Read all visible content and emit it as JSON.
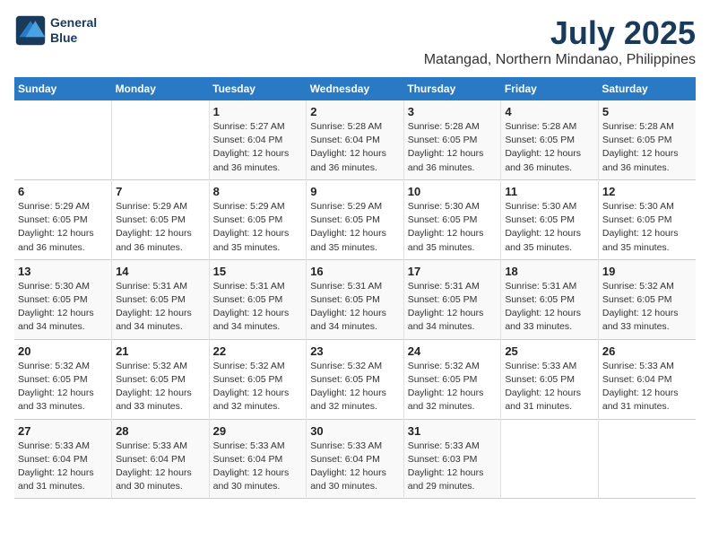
{
  "header": {
    "logo_line1": "General",
    "logo_line2": "Blue",
    "title": "July 2025",
    "subtitle": "Matangad, Northern Mindanao, Philippines"
  },
  "days_of_week": [
    "Sunday",
    "Monday",
    "Tuesday",
    "Wednesday",
    "Thursday",
    "Friday",
    "Saturday"
  ],
  "weeks": [
    [
      {
        "day": "",
        "info": ""
      },
      {
        "day": "",
        "info": ""
      },
      {
        "day": "1",
        "info": "Sunrise: 5:27 AM\nSunset: 6:04 PM\nDaylight: 12 hours and 36 minutes."
      },
      {
        "day": "2",
        "info": "Sunrise: 5:28 AM\nSunset: 6:04 PM\nDaylight: 12 hours and 36 minutes."
      },
      {
        "day": "3",
        "info": "Sunrise: 5:28 AM\nSunset: 6:05 PM\nDaylight: 12 hours and 36 minutes."
      },
      {
        "day": "4",
        "info": "Sunrise: 5:28 AM\nSunset: 6:05 PM\nDaylight: 12 hours and 36 minutes."
      },
      {
        "day": "5",
        "info": "Sunrise: 5:28 AM\nSunset: 6:05 PM\nDaylight: 12 hours and 36 minutes."
      }
    ],
    [
      {
        "day": "6",
        "info": "Sunrise: 5:29 AM\nSunset: 6:05 PM\nDaylight: 12 hours and 36 minutes."
      },
      {
        "day": "7",
        "info": "Sunrise: 5:29 AM\nSunset: 6:05 PM\nDaylight: 12 hours and 36 minutes."
      },
      {
        "day": "8",
        "info": "Sunrise: 5:29 AM\nSunset: 6:05 PM\nDaylight: 12 hours and 35 minutes."
      },
      {
        "day": "9",
        "info": "Sunrise: 5:29 AM\nSunset: 6:05 PM\nDaylight: 12 hours and 35 minutes."
      },
      {
        "day": "10",
        "info": "Sunrise: 5:30 AM\nSunset: 6:05 PM\nDaylight: 12 hours and 35 minutes."
      },
      {
        "day": "11",
        "info": "Sunrise: 5:30 AM\nSunset: 6:05 PM\nDaylight: 12 hours and 35 minutes."
      },
      {
        "day": "12",
        "info": "Sunrise: 5:30 AM\nSunset: 6:05 PM\nDaylight: 12 hours and 35 minutes."
      }
    ],
    [
      {
        "day": "13",
        "info": "Sunrise: 5:30 AM\nSunset: 6:05 PM\nDaylight: 12 hours and 34 minutes."
      },
      {
        "day": "14",
        "info": "Sunrise: 5:31 AM\nSunset: 6:05 PM\nDaylight: 12 hours and 34 minutes."
      },
      {
        "day": "15",
        "info": "Sunrise: 5:31 AM\nSunset: 6:05 PM\nDaylight: 12 hours and 34 minutes."
      },
      {
        "day": "16",
        "info": "Sunrise: 5:31 AM\nSunset: 6:05 PM\nDaylight: 12 hours and 34 minutes."
      },
      {
        "day": "17",
        "info": "Sunrise: 5:31 AM\nSunset: 6:05 PM\nDaylight: 12 hours and 34 minutes."
      },
      {
        "day": "18",
        "info": "Sunrise: 5:31 AM\nSunset: 6:05 PM\nDaylight: 12 hours and 33 minutes."
      },
      {
        "day": "19",
        "info": "Sunrise: 5:32 AM\nSunset: 6:05 PM\nDaylight: 12 hours and 33 minutes."
      }
    ],
    [
      {
        "day": "20",
        "info": "Sunrise: 5:32 AM\nSunset: 6:05 PM\nDaylight: 12 hours and 33 minutes."
      },
      {
        "day": "21",
        "info": "Sunrise: 5:32 AM\nSunset: 6:05 PM\nDaylight: 12 hours and 33 minutes."
      },
      {
        "day": "22",
        "info": "Sunrise: 5:32 AM\nSunset: 6:05 PM\nDaylight: 12 hours and 32 minutes."
      },
      {
        "day": "23",
        "info": "Sunrise: 5:32 AM\nSunset: 6:05 PM\nDaylight: 12 hours and 32 minutes."
      },
      {
        "day": "24",
        "info": "Sunrise: 5:32 AM\nSunset: 6:05 PM\nDaylight: 12 hours and 32 minutes."
      },
      {
        "day": "25",
        "info": "Sunrise: 5:33 AM\nSunset: 6:05 PM\nDaylight: 12 hours and 31 minutes."
      },
      {
        "day": "26",
        "info": "Sunrise: 5:33 AM\nSunset: 6:04 PM\nDaylight: 12 hours and 31 minutes."
      }
    ],
    [
      {
        "day": "27",
        "info": "Sunrise: 5:33 AM\nSunset: 6:04 PM\nDaylight: 12 hours and 31 minutes."
      },
      {
        "day": "28",
        "info": "Sunrise: 5:33 AM\nSunset: 6:04 PM\nDaylight: 12 hours and 30 minutes."
      },
      {
        "day": "29",
        "info": "Sunrise: 5:33 AM\nSunset: 6:04 PM\nDaylight: 12 hours and 30 minutes."
      },
      {
        "day": "30",
        "info": "Sunrise: 5:33 AM\nSunset: 6:04 PM\nDaylight: 12 hours and 30 minutes."
      },
      {
        "day": "31",
        "info": "Sunrise: 5:33 AM\nSunset: 6:03 PM\nDaylight: 12 hours and 29 minutes."
      },
      {
        "day": "",
        "info": ""
      },
      {
        "day": "",
        "info": ""
      }
    ]
  ]
}
